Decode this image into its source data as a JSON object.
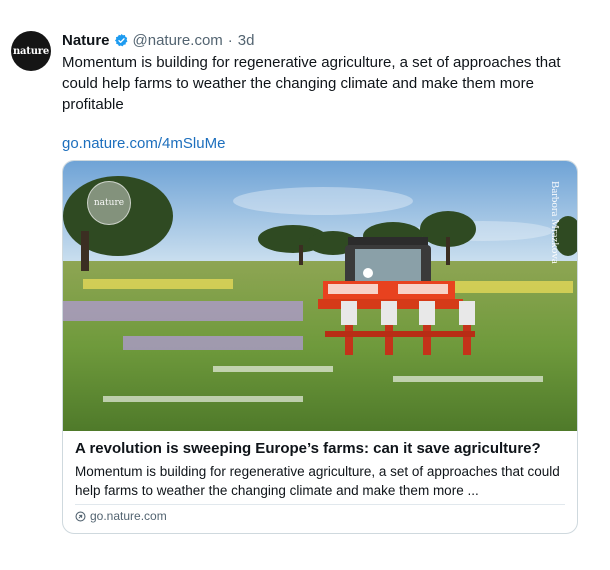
{
  "post": {
    "avatar_text": "nature",
    "author": "Nature",
    "verified": true,
    "handle": "@nature.com",
    "separator": "·",
    "time": "3d",
    "text": "Momentum is building for regenerative agriculture, a set of approaches that could help farms to weather the changing climate and make them more profitable",
    "link": "go.nature.com/4mSluMe"
  },
  "card": {
    "image_logo_text": "nature",
    "image_credit": "Barbora Mrazkova",
    "title": "A revolution is sweeping Europe’s farms: can it save agriculture?",
    "description": "Momentum is building for regenerative agriculture, a set of approaches that could help farms to weather the changing climate and make them more ...",
    "domain": "go.nature.com"
  },
  "colors": {
    "link": "#1d6fbd",
    "verified": "#1d9bf0",
    "muted": "#536471",
    "tractor": "#e8421f"
  }
}
